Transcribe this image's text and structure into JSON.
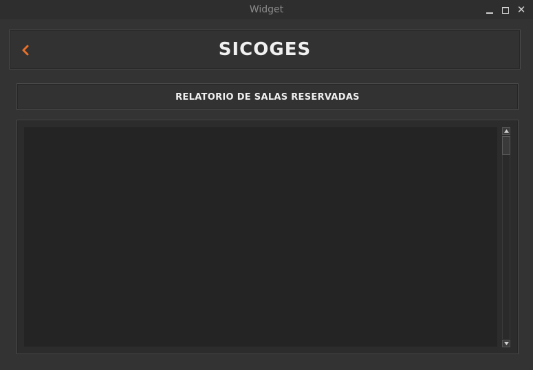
{
  "window": {
    "title": "Widget",
    "controls": [
      "minimize-icon",
      "maximize-icon",
      "close-icon"
    ]
  },
  "header": {
    "back_icon": "chevron-left-icon",
    "title": "SICOGES"
  },
  "report_button": {
    "label": "RELATORIO DE SALAS RESERVADAS"
  },
  "list": {
    "items": []
  },
  "colors": {
    "background": "#333333",
    "accent": "#e8702a",
    "text": "#f0f0f0"
  }
}
